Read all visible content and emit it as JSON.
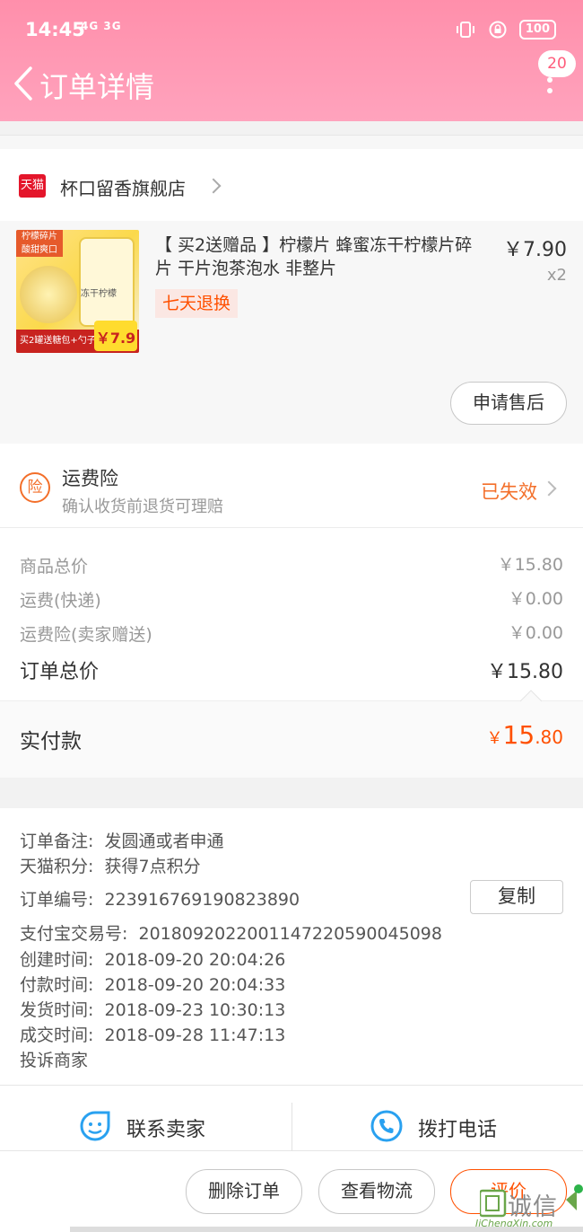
{
  "status_bar": {
    "time": "14:45",
    "network": "4G 3G",
    "battery": "100"
  },
  "header": {
    "title": "订单详情",
    "badge_count": "20"
  },
  "store": {
    "logo_text": "天猫",
    "name": "杯口留香旗舰店"
  },
  "product": {
    "title": "【 买2送赠品 】柠檬片 蜂蜜冻干柠檬片碎片 干片泡茶泡水 非整片",
    "price": "￥7.90",
    "quantity": "x2",
    "return_tag": "七天退换",
    "image_tag": "柠檬碎片 酸甜爽口",
    "image_can_label": "冻干柠檬",
    "image_bottom": "买2罐送糖包+勺子",
    "image_price": "￥7.9",
    "after_sale_button": "申请售后"
  },
  "insurance": {
    "icon": "险",
    "title": "运费险",
    "subtitle": "确认收货前退货可理赔",
    "status": "已失效"
  },
  "price": {
    "rows": [
      {
        "label": "商品总价",
        "value": "￥15.80"
      },
      {
        "label": "运费(快递)",
        "value": "￥0.00"
      },
      {
        "label": "运费险(卖家赠送)",
        "value": "￥0.00"
      }
    ],
    "total_label": "订单总价",
    "total_value": "￥15.80",
    "paid_label": "实付款",
    "paid_currency": "￥",
    "paid_int": "15",
    "paid_dec": ".80"
  },
  "details": {
    "remark_label": "订单备注:",
    "remark_value": "发圆通或者申通",
    "points_label": "天猫积分:",
    "points_value": "获得7点积分",
    "order_no_label": "订单编号:",
    "order_no_value": "223916769190823890",
    "copy_button": "复制",
    "alipay_label": "支付宝交易号:",
    "alipay_value": "2018092022001147220590045098",
    "created_label": "创建时间:",
    "created_value": "2018-09-20 20:04:26",
    "paid_label": "付款时间:",
    "paid_value": "2018-09-20 20:04:33",
    "shipped_label": "发货时间:",
    "shipped_value": "2018-09-23 10:30:13",
    "completed_label": "成交时间:",
    "completed_value": "2018-09-28 11:47:13",
    "complaint": "投诉商家"
  },
  "contact": {
    "seller": "联系卖家",
    "phone": "拨打电话"
  },
  "actions": {
    "delete": "删除订单",
    "logistics": "查看物流",
    "review": "评价"
  },
  "watermark": {
    "text": "诚信",
    "sub": "JiChengXin.com"
  },
  "colors": {
    "header_pink": "#ff93ae",
    "accent_orange": "#ff5000",
    "contact_blue": "#29a1f0"
  }
}
